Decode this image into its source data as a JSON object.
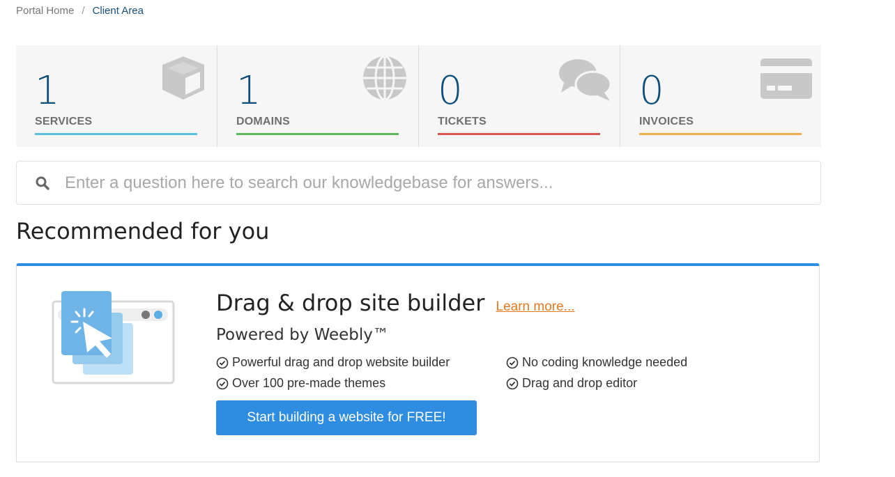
{
  "breadcrumb": {
    "home": "Portal Home",
    "separator": "/",
    "current": "Client Area"
  },
  "stats": [
    {
      "count": "1",
      "label": "SERVICES",
      "color": "#5bc0de",
      "icon": "cube-icon"
    },
    {
      "count": "1",
      "label": "DOMAINS",
      "color": "#5cb85c",
      "icon": "globe-icon"
    },
    {
      "count": "0",
      "label": "TICKETS",
      "color": "#d9534f",
      "icon": "comments-icon"
    },
    {
      "count": "0",
      "label": "INVOICES",
      "color": "#f0ad4e",
      "icon": "credit-card-icon"
    }
  ],
  "search": {
    "placeholder": "Enter a question here to search our knowledgebase for answers...",
    "icon": "search-icon"
  },
  "recommended": {
    "title": "Recommended for you",
    "card": {
      "heading": "Drag & drop site builder",
      "learn_more": "Learn more...",
      "subheading": "Powered by Weebly™",
      "features": [
        "Powerful drag and drop website builder",
        "No coding knowledge needed",
        "Over 100 pre-made themes",
        "Drag and drop editor"
      ],
      "cta": "Start building a website for FREE!",
      "accent": "#2e8de0",
      "link_color": "#e27a20"
    }
  }
}
